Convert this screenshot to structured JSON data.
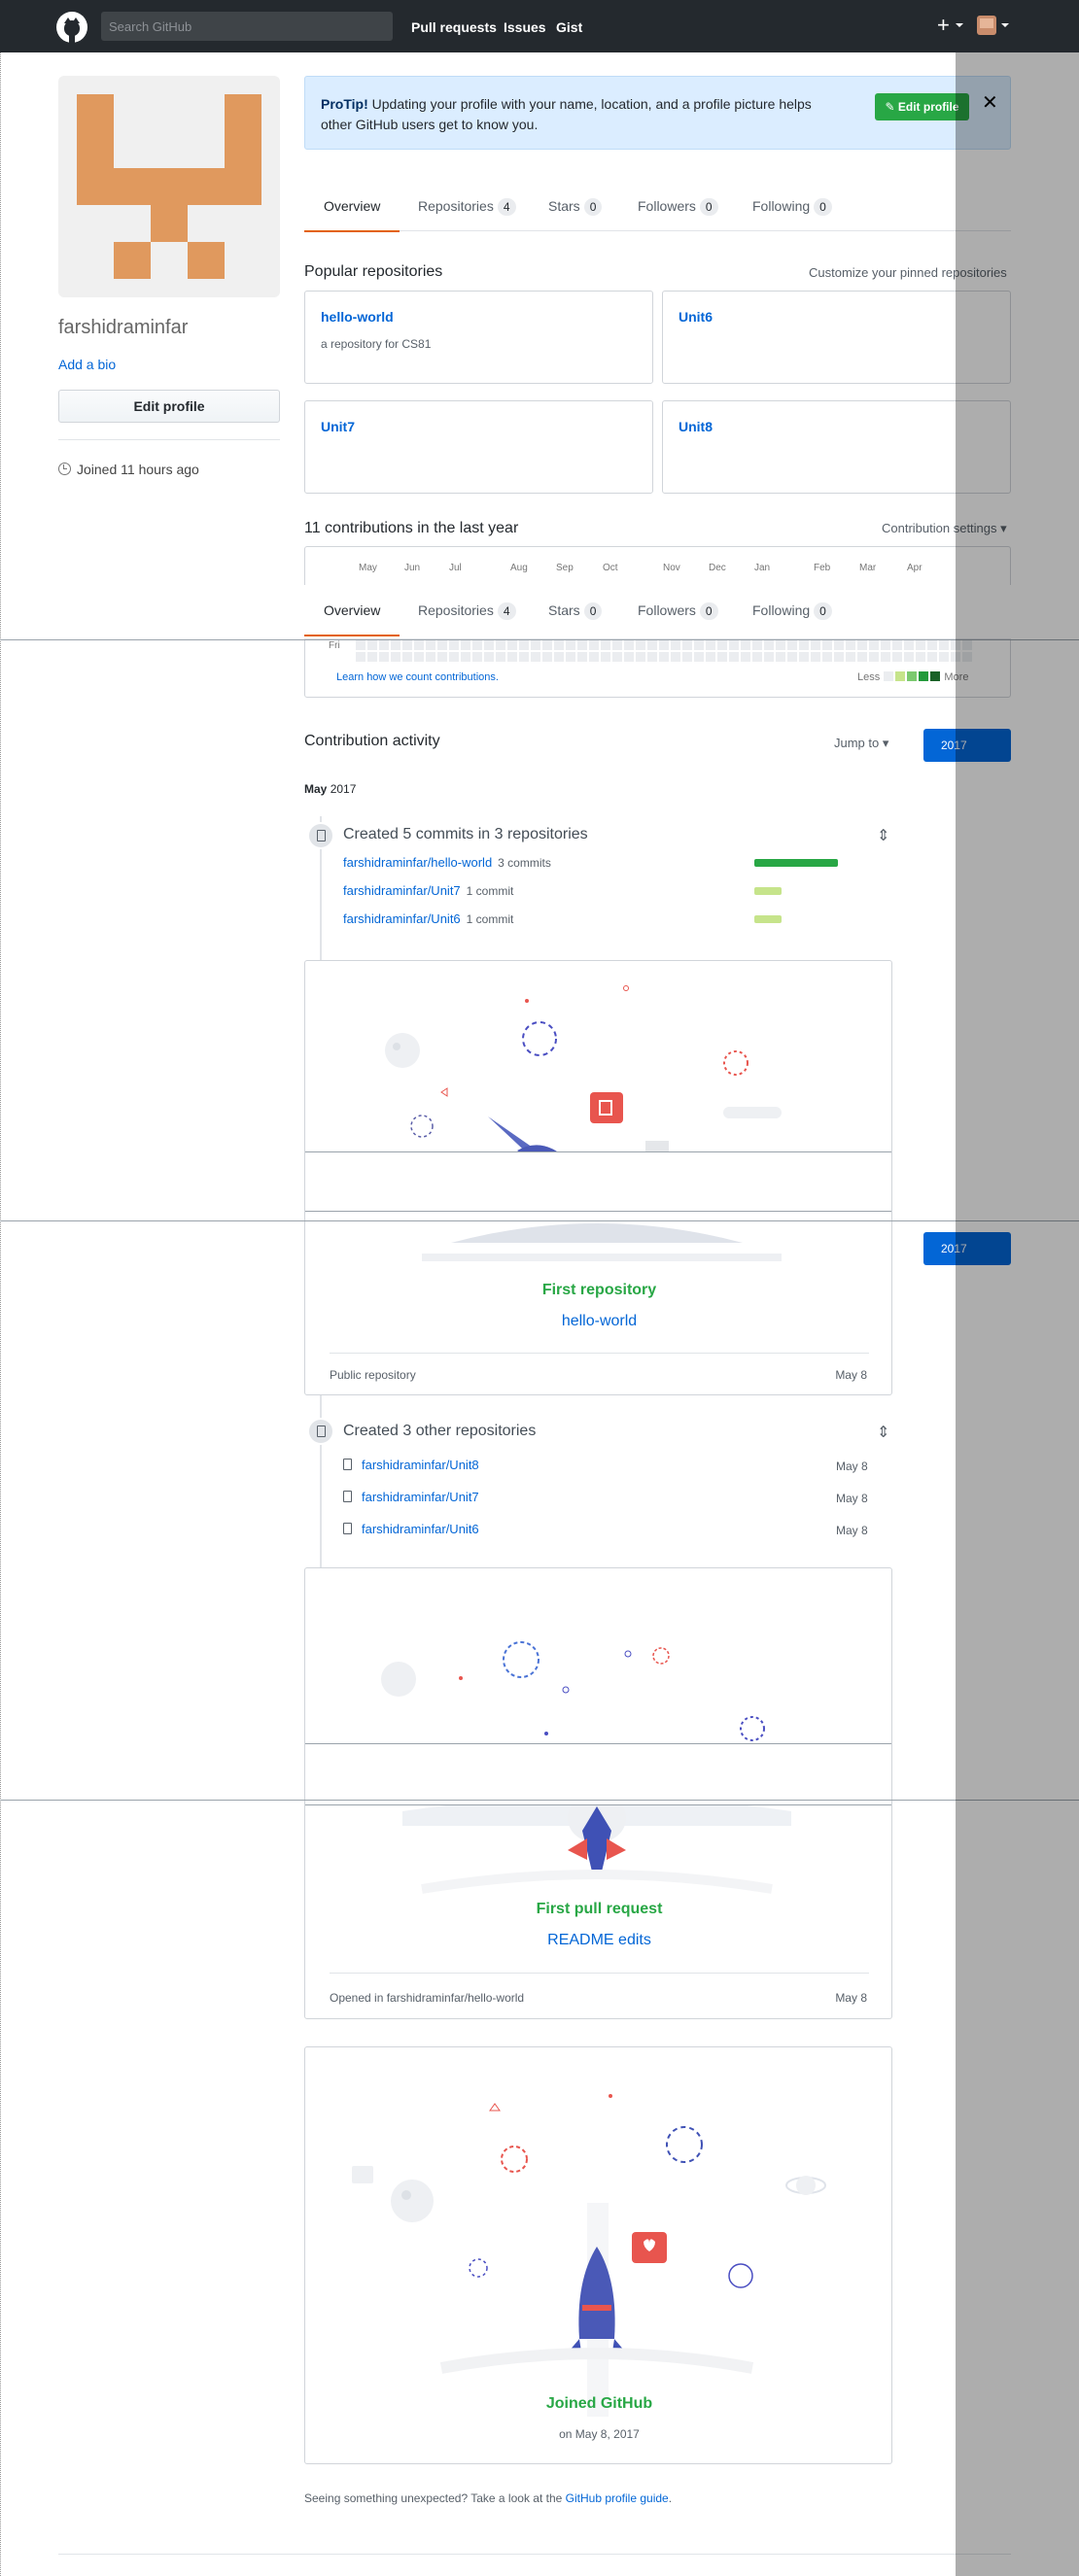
{
  "header": {
    "search_placeholder": "Search GitHub",
    "nav": [
      "Pull requests",
      "Issues",
      "Gist"
    ],
    "plus": "+"
  },
  "profile": {
    "username": "farshidraminfar",
    "add_bio": "Add a bio",
    "edit_profile": "Edit profile",
    "joined": "Joined 11 hours ago",
    "identicon_color": "#e0995e"
  },
  "protip": {
    "label": "ProTip!",
    "text": "Updating your profile with your name, location, and a profile picture helps other GitHub users get to know you.",
    "button": "Edit profile",
    "close": "✕"
  },
  "tabs": [
    {
      "label": "Overview",
      "count": null
    },
    {
      "label": "Repositories",
      "count": "4"
    },
    {
      "label": "Stars",
      "count": "0"
    },
    {
      "label": "Followers",
      "count": "0"
    },
    {
      "label": "Following",
      "count": "0"
    }
  ],
  "popular": {
    "title": "Popular repositories",
    "customize": "Customize your pinned repositories",
    "repos": [
      {
        "name": "hello-world",
        "desc": "a repository for CS81"
      },
      {
        "name": "Unit6",
        "desc": ""
      },
      {
        "name": "Unit7",
        "desc": ""
      },
      {
        "name": "Unit8",
        "desc": ""
      }
    ]
  },
  "contributions": {
    "title": "11 contributions in the last year",
    "settings": "Contribution settings ▾",
    "months": [
      "May",
      "Jun",
      "Jul",
      "Aug",
      "Sep",
      "Oct",
      "Nov",
      "Dec",
      "Jan",
      "Feb",
      "Mar",
      "Apr"
    ],
    "day_label": "Fri",
    "learn": "Learn how we count contributions.",
    "less": "Less",
    "more": "More",
    "colors": [
      "#ebedf0",
      "#c6e48b",
      "#7bc96f",
      "#239a3b",
      "#196127"
    ]
  },
  "activity": {
    "title": "Contribution activity",
    "jump_to": "Jump to ▾",
    "year": "2017",
    "month": "May",
    "month_year": "2017",
    "commits_title": "Created 5 commits in 3 repositories",
    "commits": [
      {
        "repo": "farshidraminfar/hello-world",
        "meta": "3 commits",
        "fraction": 1.0
      },
      {
        "repo": "farshidraminfar/Unit7",
        "meta": "1 commit",
        "fraction": 0.33
      },
      {
        "repo": "farshidraminfar/Unit6",
        "meta": "1 commit",
        "fraction": 0.33
      }
    ],
    "first_repo": {
      "title": "First repository",
      "name": "hello-world",
      "foot_left": "Public repository",
      "foot_right": "May 8"
    },
    "other_title": "Created 3 other repositories",
    "other_repos": [
      {
        "repo": "farshidraminfar/Unit8",
        "date": "May 8"
      },
      {
        "repo": "farshidraminfar/Unit7",
        "date": "May 8"
      },
      {
        "repo": "farshidraminfar/Unit6",
        "date": "May 8"
      }
    ],
    "first_pr": {
      "title": "First pull request",
      "name": "README edits",
      "foot_left": "Opened in farshidraminfar/hello-world",
      "foot_right": "May 8"
    },
    "joined": {
      "title": "Joined GitHub",
      "date": "on May 8, 2017"
    }
  },
  "footer": {
    "text": "Seeing something unexpected? Take a look at the",
    "link": "GitHub profile guide",
    "end": "."
  }
}
